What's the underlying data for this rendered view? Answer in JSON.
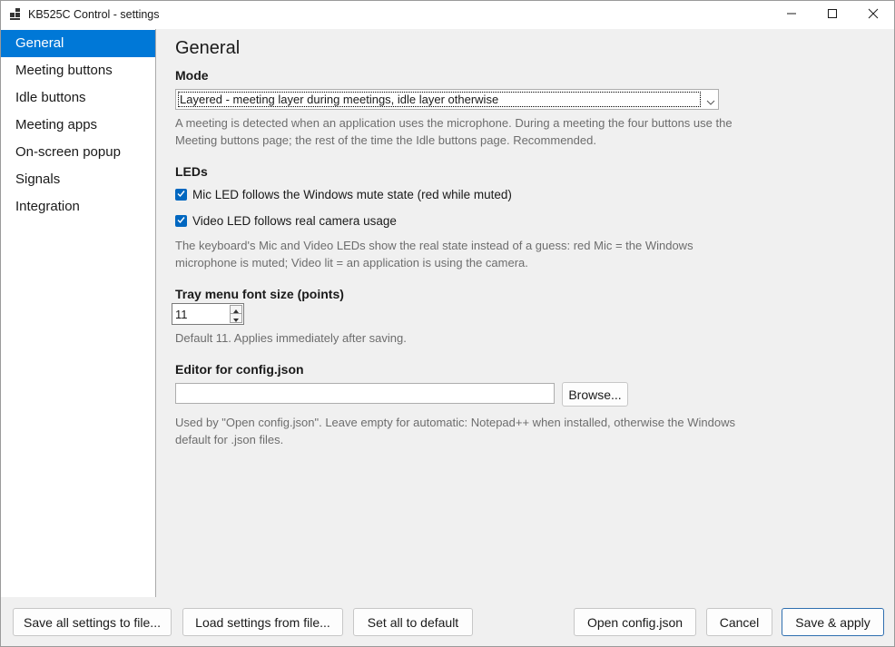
{
  "window": {
    "title": "KB525C Control - settings"
  },
  "icons": {
    "app": "app-grid-icon",
    "minimize": "minimize-icon",
    "maximize": "maximize-icon",
    "close": "close-icon",
    "dropdown": "chevron-down-icon",
    "check": "checkmark-icon",
    "stepper_up": "caret-up-icon",
    "stepper_down": "caret-down-icon"
  },
  "colors": {
    "accent": "#0078d7",
    "checkbox": "#0067c0",
    "help_text": "#6d6d6d",
    "primary_border": "#2f6fb0"
  },
  "sidebar": {
    "items": [
      {
        "label": "General",
        "active": true
      },
      {
        "label": "Meeting buttons",
        "active": false
      },
      {
        "label": "Idle buttons",
        "active": false
      },
      {
        "label": "Meeting apps",
        "active": false
      },
      {
        "label": "On-screen popup",
        "active": false
      },
      {
        "label": "Signals",
        "active": false
      },
      {
        "label": "Integration",
        "active": false
      }
    ]
  },
  "main": {
    "title": "General",
    "mode": {
      "label": "Mode",
      "selected": "Layered - meeting layer during meetings, idle layer otherwise",
      "help": "A meeting is detected when an application uses the microphone. During a meeting the four buttons use the Meeting buttons page; the rest of the time the Idle buttons page. Recommended."
    },
    "leds": {
      "label": "LEDs",
      "mic_checkbox": {
        "label": "Mic LED follows the Windows mute state (red while muted)",
        "checked": true
      },
      "video_checkbox": {
        "label": "Video LED follows real camera usage",
        "checked": true
      },
      "help": "The keyboard's Mic and Video LEDs show the real state instead of a guess: red Mic = the Windows microphone is muted; Video lit = an application is using the camera."
    },
    "font_size": {
      "label": "Tray menu font size (points)",
      "value": "11",
      "help": "Default 11. Applies immediately after saving."
    },
    "editor": {
      "label": "Editor for config.json",
      "value": "",
      "browse_label": "Browse...",
      "help": "Used by \"Open config.json\". Leave empty for automatic: Notepad++ when installed, otherwise the Windows default for .json files."
    }
  },
  "footer": {
    "save_all": "Save all settings to file...",
    "load": "Load settings from file...",
    "set_default": "Set all to default",
    "open_config": "Open config.json",
    "cancel": "Cancel",
    "save_apply": "Save & apply"
  }
}
